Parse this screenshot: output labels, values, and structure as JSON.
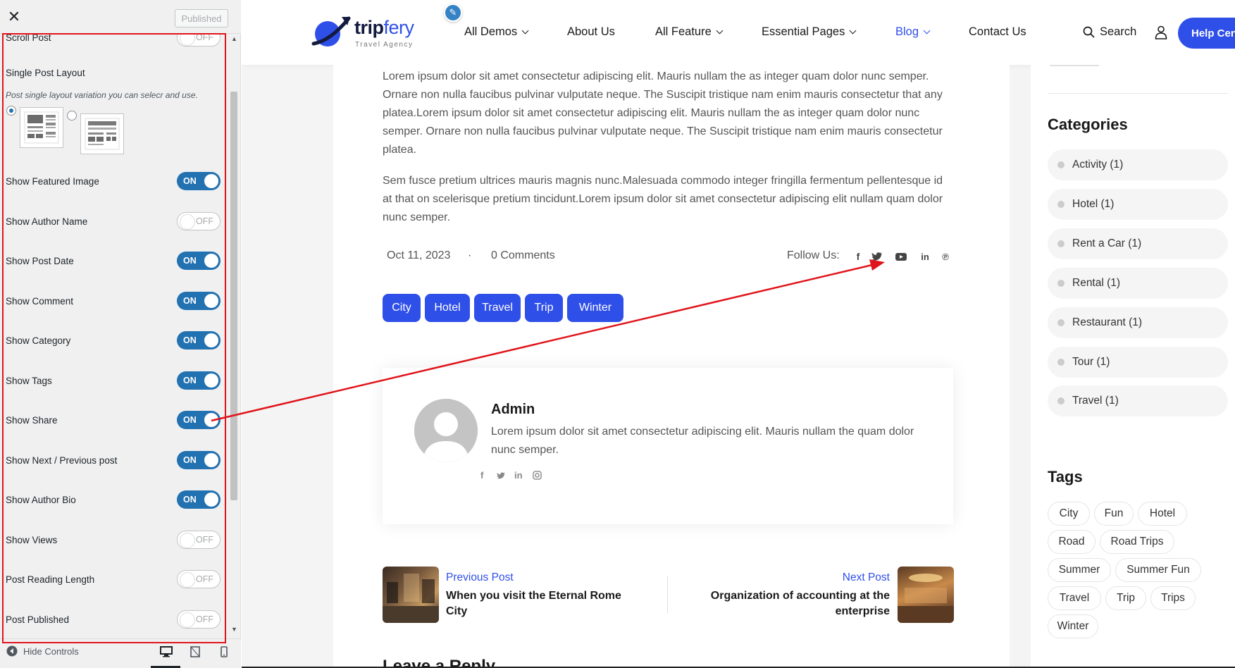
{
  "customizer": {
    "published_label": "Published",
    "partial_top_label": "Scroll Post",
    "partial_top_value": "OFF",
    "layout_title": "Single Post Layout",
    "layout_desc": "Post single layout variation you can selecr and use.",
    "toggles": [
      {
        "label": "Show Featured Image",
        "value": "ON"
      },
      {
        "label": "Show Author Name",
        "value": "OFF"
      },
      {
        "label": "Show Post Date",
        "value": "ON"
      },
      {
        "label": "Show Comment",
        "value": "ON"
      },
      {
        "label": "Show Category",
        "value": "ON"
      },
      {
        "label": "Show Tags",
        "value": "ON"
      },
      {
        "label": "Show Share",
        "value": "ON"
      },
      {
        "label": "Show Next / Previous post",
        "value": "ON"
      },
      {
        "label": "Show Author Bio",
        "value": "ON"
      },
      {
        "label": "Show Views",
        "value": "OFF"
      },
      {
        "label": "Post Reading Length",
        "value": "OFF"
      },
      {
        "label": "Post Published",
        "value": "OFF"
      }
    ],
    "hide_controls_label": "Hide Controls",
    "accent_color": "#2271b1",
    "highlight_color": "#e0141b"
  },
  "site": {
    "logo_part1": "trip",
    "logo_part2": "fery",
    "logo_sub": "Travel Agency",
    "nav": [
      {
        "label": "All Demos",
        "dropdown": true
      },
      {
        "label": "About Us",
        "dropdown": false
      },
      {
        "label": "All Feature",
        "dropdown": true
      },
      {
        "label": "Essential Pages",
        "dropdown": true
      },
      {
        "label": "Blog",
        "dropdown": true,
        "active": true
      },
      {
        "label": "Contact Us",
        "dropdown": false
      }
    ],
    "search_label": "Search",
    "help_label": "Help Center",
    "brand_color": "#2f4fe9"
  },
  "post": {
    "paragraph1": "Lorem ipsum dolor sit amet consectetur adipiscing elit. Mauris nullam the as integer quam dolor nunc semper. Ornare non nulla faucibus pulvinar vulputate neque. The Suscipit tristique nam enim mauris consectetur that any platea.Lorem ipsum dolor sit amet consectetur adipiscing elit. Mauris nullam the as integer quam dolor nunc semper. Ornare non nulla faucibus pulvinar vulputate neque. The Suscipit tristique nam enim mauris consectetur platea.",
    "paragraph2": "Sem fusce pretium ultrices mauris magnis nunc.Malesuada commodo integer fringilla fermentum pellentesque id at that on scelerisque pretium tincidunt.Lorem ipsum dolor sit amet consectetur adipiscing elit nullam quam dolor nunc semper.",
    "date": "Oct 11, 2023",
    "dot": "·",
    "comments": "0 Comments",
    "follow_label": "Follow Us:",
    "share_icons": [
      "facebook-icon",
      "twitter-icon",
      "youtube-icon",
      "linkedin-icon",
      "pinterest-icon"
    ],
    "tags": [
      "City",
      "Hotel",
      "Travel",
      "Trip",
      "Winter"
    ],
    "author": {
      "name": "Admin",
      "bio": "Lorem ipsum dolor sit amet consectetur adipiscing elit. Mauris nullam the quam dolor nunc semper.",
      "social_icons": [
        "facebook-icon",
        "twitter-icon",
        "linkedin-icon",
        "instagram-icon"
      ]
    },
    "prev": {
      "label": "Previous Post",
      "title": "When you visit the Eternal Rome City"
    },
    "next": {
      "label": "Next Post",
      "title": "Organization of accounting at the enterprise"
    },
    "reply_title": "Leave a Reply"
  },
  "sidebar_widgets": {
    "categories_title": "Categories",
    "categories": [
      "Activity (1)",
      "Hotel (1)",
      "Rent a Car (1)",
      "Rental (1)",
      "Restaurant (1)",
      "Tour (1)",
      "Travel (1)"
    ],
    "tags_title": "Tags",
    "tags": [
      "City",
      "Fun",
      "Hotel",
      "Road",
      "Road Trips",
      "Summer",
      "Summer Fun",
      "Travel",
      "Trip",
      "Trips",
      "Winter"
    ]
  }
}
